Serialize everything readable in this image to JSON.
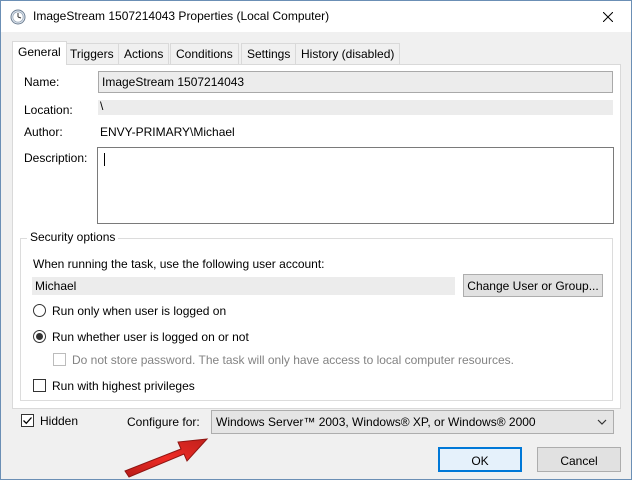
{
  "window": {
    "title": "ImageStream 1507214043 Properties (Local Computer)"
  },
  "tabs": [
    {
      "label": "General"
    },
    {
      "label": "Triggers"
    },
    {
      "label": "Actions"
    },
    {
      "label": "Conditions"
    },
    {
      "label": "Settings"
    },
    {
      "label": "History (disabled)"
    }
  ],
  "general": {
    "name_label": "Name:",
    "name_value": "ImageStream 1507214043",
    "location_label": "Location:",
    "location_value": "\\",
    "author_label": "Author:",
    "author_value": "ENVY-PRIMARY\\Michael",
    "description_label": "Description:",
    "description_value": ""
  },
  "security": {
    "title": "Security options",
    "account_prompt": "When running the task, use the following user account:",
    "user_account": "Michael",
    "change_button": "Change User or Group...",
    "radio_logged_on": "Run only when user is logged on",
    "radio_whether": "Run whether user is logged on or not",
    "no_store_password": "Do not store password.  The task will only have access to local computer resources.",
    "highest_privileges": "Run with highest privileges"
  },
  "bottom": {
    "hidden_label": "Hidden",
    "configure_label": "Configure for:",
    "configure_value": "Windows Server™ 2003, Windows® XP, or Windows® 2000",
    "ok_label": "OK",
    "cancel_label": "Cancel"
  },
  "colors": {
    "window_bg": "#f0f0f0",
    "arrow": "#e8251f",
    "accent_border": "#0078d7"
  }
}
